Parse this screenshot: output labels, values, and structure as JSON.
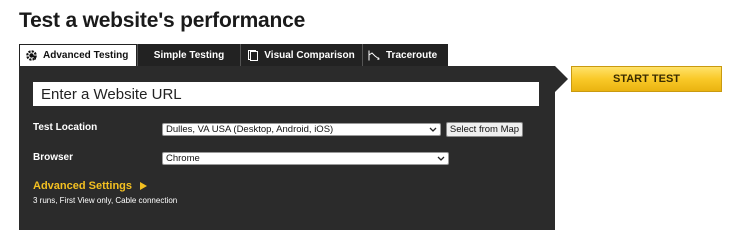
{
  "page": {
    "title": "Test a website's performance"
  },
  "tabs": [
    {
      "label": "Advanced Testing",
      "icon": "gear-icon",
      "active": true
    },
    {
      "label": "Simple Testing",
      "icon": "",
      "active": false
    },
    {
      "label": "Visual Comparison",
      "icon": "document-icon",
      "active": false
    },
    {
      "label": "Traceroute",
      "icon": "traceroute-icon",
      "active": false
    }
  ],
  "form": {
    "url_placeholder": "Enter a Website URL",
    "url_value": "",
    "test_location_label": "Test Location",
    "test_location_value": "Dulles, VA USA (Desktop, Android, iOS)",
    "select_from_map_label": "Select from Map",
    "browser_label": "Browser",
    "browser_value": "Chrome",
    "advanced_settings_label": "Advanced Settings",
    "advanced_settings_summary": "3 runs, First View only, Cable connection"
  },
  "actions": {
    "start_test_label": "START TEST"
  },
  "colors": {
    "panel_bg": "#2b2b2b",
    "tab_bg": "#222222",
    "accent_yellow": "#f4c021",
    "button_gradient_top": "#ffe26a",
    "button_gradient_bottom": "#eab310"
  }
}
